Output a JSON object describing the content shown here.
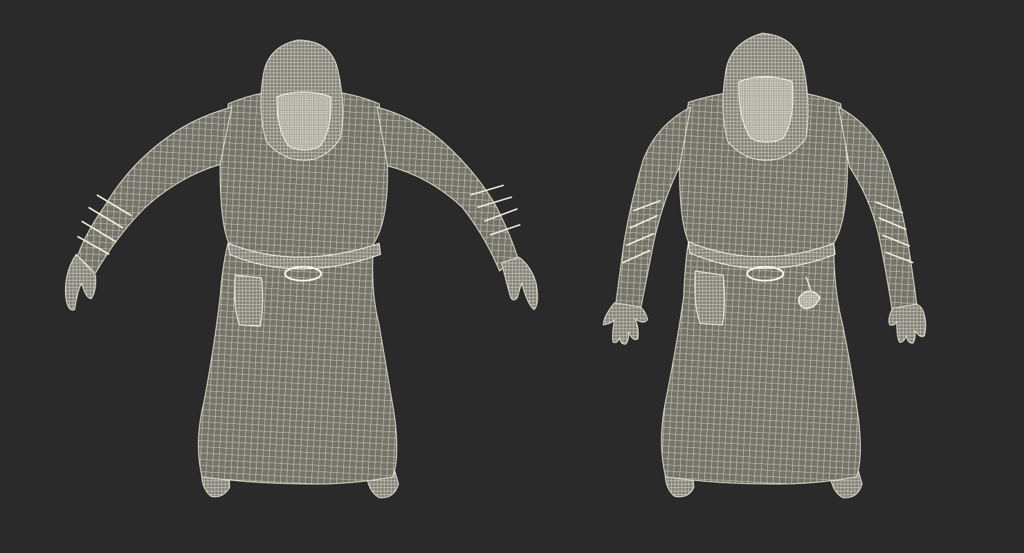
{
  "scene": {
    "background_color": "#2a2a2a",
    "mesh_fill_color": "#74746a",
    "wire_color": "#ecebd8",
    "highlight_color": "#fbfbef"
  },
  "models": [
    {
      "id": "robed-figure-mesh-left",
      "pose": "arms-spread"
    },
    {
      "id": "robed-figure-mesh-right",
      "pose": "arms-lowered"
    }
  ]
}
